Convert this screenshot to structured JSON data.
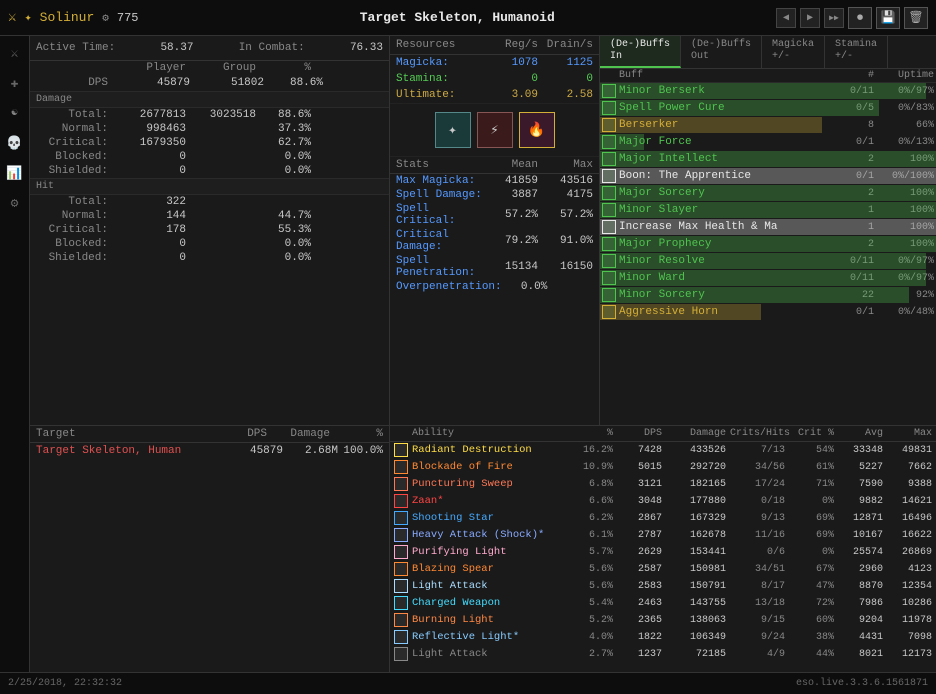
{
  "topbar": {
    "player_icon": "⚔",
    "player_star": "✦",
    "player_name": "Solinur",
    "cp_icon": "⚙",
    "cp_value": "775",
    "title": "Target Skeleton, Humanoid",
    "nav_prev": "◀",
    "nav_next": "▶",
    "nav_skip": "▶▶",
    "btn_record": "⏺",
    "btn_save": "⬇",
    "btn_delete": "🗑"
  },
  "stats": {
    "active_time_label": "Active Time:",
    "active_time_value": "58.37",
    "in_combat_label": "In Combat:",
    "in_combat_value": "76.33",
    "col_player": "Player",
    "col_group": "Group",
    "col_pct": "%",
    "dps_label": "DPS",
    "dps_player": "45879",
    "dps_group": "51802",
    "dps_pct": "88.6%",
    "damage_label": "Damage",
    "total_label": "Total:",
    "total_player": "2677813",
    "total_group": "3023518",
    "total_pct": "88.6%",
    "normal_label": "Normal:",
    "normal_player": "998463",
    "normal_pct": "37.3%",
    "critical_label": "Critical:",
    "critical_player": "1679350",
    "critical_pct": "62.7%",
    "blocked_label": "Blocked:",
    "blocked_player": "0",
    "blocked_pct": "0.0%",
    "shielded_label": "Shielded:",
    "shielded_player": "0",
    "shielded_pct": "0.0%",
    "hit_label": "Hit",
    "hit_total_label": "Total:",
    "hit_total": "322",
    "hit_normal_label": "Normal:",
    "hit_normal": "144",
    "hit_normal_pct": "44.7%",
    "hit_critical_label": "Critical:",
    "hit_critical": "178",
    "hit_critical_pct": "55.3%",
    "hit_blocked_label": "Blocked:",
    "hit_blocked": "0",
    "hit_blocked_pct": "0.0%",
    "hit_shielded_label": "Shielded:",
    "hit_shielded": "0",
    "hit_shielded_pct": "0.0%"
  },
  "resources": {
    "header_name": "Resources",
    "header_regs": "Reg/s",
    "header_drain": "Drain/s",
    "magicka_label": "Magicka:",
    "magicka_reg": "1078",
    "magicka_drain": "1125",
    "stamina_label": "Stamina:",
    "stamina_reg": "0",
    "stamina_drain": "0",
    "ultimate_label": "Ultimate:",
    "ultimate_reg": "3.09",
    "ultimate_drain": "2.58",
    "stats_header_name": "Stats",
    "stats_header_mean": "Mean",
    "stats_header_max": "Max",
    "max_magicka_label": "Max Magicka:",
    "max_magicka_mean": "41859",
    "max_magicka_max": "43516",
    "spell_damage_label": "Spell Damage:",
    "spell_damage_mean": "3887",
    "spell_damage_max": "4175",
    "spell_critical_label": "Spell Critical:",
    "spell_critical_mean": "57.2%",
    "spell_critical_max": "57.2%",
    "critical_damage_label": "Critical Damage:",
    "critical_damage_mean": "79.2%",
    "critical_damage_max": "91.0%",
    "spell_pen_label": "Spell Penetration:",
    "spell_pen_mean": "15134",
    "spell_pen_max": "16150",
    "overpenetration_label": "Overpenetration:",
    "overpenetration_mean": "0.0%",
    "overpenetration_max": ""
  },
  "buffs": {
    "tab_debuffs_in": "(De-)Buffs\nIn",
    "tab_debuffs_out": "(De-)Buffs\nOut",
    "tab_magicka": "Magicka\n+/-",
    "tab_stamina": "Stamina\n+/-",
    "col_buff": "Buff",
    "col_count": "#",
    "col_uptime": "Uptime",
    "items": [
      {
        "name": "Minor Berserk",
        "count": "0/11",
        "uptime": "0%/97%",
        "color": "green",
        "bar": 97
      },
      {
        "name": "Spell Power Cure",
        "count": "0/5",
        "uptime": "0%/83%",
        "color": "green",
        "bar": 83
      },
      {
        "name": "Berserker",
        "count": "8",
        "uptime": "66%",
        "color": "yellow",
        "bar": 66
      },
      {
        "name": "Major Force",
        "count": "0/1",
        "uptime": "0%/13%",
        "color": "green",
        "bar": 13
      },
      {
        "name": "Major Intellect",
        "count": "2",
        "uptime": "100%",
        "color": "green",
        "bar": 100
      },
      {
        "name": "Boon: The Apprentice",
        "count": "0/1",
        "uptime": "0%/100%",
        "color": "white",
        "bar": 100
      },
      {
        "name": "Major Sorcery",
        "count": "2",
        "uptime": "100%",
        "color": "green",
        "bar": 100
      },
      {
        "name": "Minor Slayer",
        "count": "1",
        "uptime": "100%",
        "color": "green",
        "bar": 100
      },
      {
        "name": "Increase Max Health & Ma",
        "count": "1",
        "uptime": "100%",
        "color": "white",
        "bar": 100
      },
      {
        "name": "Major Prophecy",
        "count": "2",
        "uptime": "100%",
        "color": "green",
        "bar": 100
      },
      {
        "name": "Minor Resolve",
        "count": "0/11",
        "uptime": "0%/97%",
        "color": "green",
        "bar": 97
      },
      {
        "name": "Minor Ward",
        "count": "0/11",
        "uptime": "0%/97%",
        "color": "green",
        "bar": 97
      },
      {
        "name": "Minor Sorcery",
        "count": "22",
        "uptime": "92%",
        "color": "green",
        "bar": 92
      },
      {
        "name": "Aggressive Horn",
        "count": "0/1",
        "uptime": "0%/48%",
        "color": "yellow",
        "bar": 48
      }
    ]
  },
  "targets": {
    "col_target": "Target",
    "col_dps": "DPS",
    "col_damage": "Damage",
    "col_pct": "%",
    "items": [
      {
        "name": "Target Skeleton, Human",
        "dps": "45879",
        "damage": "2.68M",
        "pct": "100.0%"
      }
    ]
  },
  "abilities": {
    "col_ability": "Ability",
    "col_pct": "%",
    "col_dps": "DPS",
    "col_damage": "Damage",
    "col_crits": "Crits/Hits",
    "col_critpct": "Crit %",
    "col_avg": "Avg",
    "col_max": "Max",
    "items": [
      {
        "name": "Radiant Destruction",
        "pct": "16.2%",
        "dps": "7428",
        "damage": "433526",
        "crits": "7/13",
        "critpct": "54%",
        "avg": "33348",
        "max": "49831",
        "color": "radiant"
      },
      {
        "name": "Blockade of Fire",
        "pct": "10.9%",
        "dps": "5015",
        "damage": "292720",
        "crits": "34/56",
        "critpct": "61%",
        "avg": "5227",
        "max": "7662",
        "color": "blockade"
      },
      {
        "name": "Puncturing Sweep",
        "pct": "6.8%",
        "dps": "3121",
        "damage": "182165",
        "crits": "17/24",
        "critpct": "71%",
        "avg": "7590",
        "max": "9388",
        "color": "puncturing"
      },
      {
        "name": "Zaan*",
        "pct": "6.6%",
        "dps": "3048",
        "damage": "177880",
        "crits": "0/18",
        "critpct": "0%",
        "avg": "9882",
        "max": "14621",
        "color": "zaan"
      },
      {
        "name": "Shooting Star",
        "pct": "6.2%",
        "dps": "2867",
        "damage": "167329",
        "crits": "9/13",
        "critpct": "69%",
        "avg": "12871",
        "max": "16496",
        "color": "shooting"
      },
      {
        "name": "Heavy Attack (Shock)*",
        "pct": "6.1%",
        "dps": "2787",
        "damage": "162678",
        "crits": "11/16",
        "critpct": "69%",
        "avg": "10167",
        "max": "16622",
        "color": "heavy"
      },
      {
        "name": "Purifying Light",
        "pct": "5.7%",
        "dps": "2629",
        "damage": "153441",
        "crits": "0/6",
        "critpct": "0%",
        "avg": "25574",
        "max": "26869",
        "color": "purifying"
      },
      {
        "name": "Blazing Spear",
        "pct": "5.6%",
        "dps": "2587",
        "damage": "150981",
        "crits": "34/51",
        "critpct": "67%",
        "avg": "2960",
        "max": "4123",
        "color": "blazing"
      },
      {
        "name": "Light Attack",
        "pct": "5.6%",
        "dps": "2583",
        "damage": "150791",
        "crits": "8/17",
        "critpct": "47%",
        "avg": "8870",
        "max": "12354",
        "color": "light"
      },
      {
        "name": "Charged Weapon",
        "pct": "5.4%",
        "dps": "2463",
        "damage": "143755",
        "crits": "13/18",
        "critpct": "72%",
        "avg": "7986",
        "max": "10286",
        "color": "charged"
      },
      {
        "name": "Burning Light",
        "pct": "5.2%",
        "dps": "2365",
        "damage": "138063",
        "crits": "9/15",
        "critpct": "60%",
        "avg": "9204",
        "max": "11978",
        "color": "burning"
      },
      {
        "name": "Reflective Light*",
        "pct": "4.0%",
        "dps": "1822",
        "damage": "106349",
        "crits": "9/24",
        "critpct": "38%",
        "avg": "4431",
        "max": "7098",
        "color": "reflective"
      },
      {
        "name": "Light Attack",
        "pct": "2.7%",
        "dps": "1237",
        "damage": "72185",
        "crits": "4/9",
        "critpct": "44%",
        "avg": "8021",
        "max": "12173",
        "color": "dim"
      }
    ]
  },
  "statusbar": {
    "timestamp": "2/25/2018, 22:32:32",
    "version": "eso.live.3.3.6.1561871"
  }
}
